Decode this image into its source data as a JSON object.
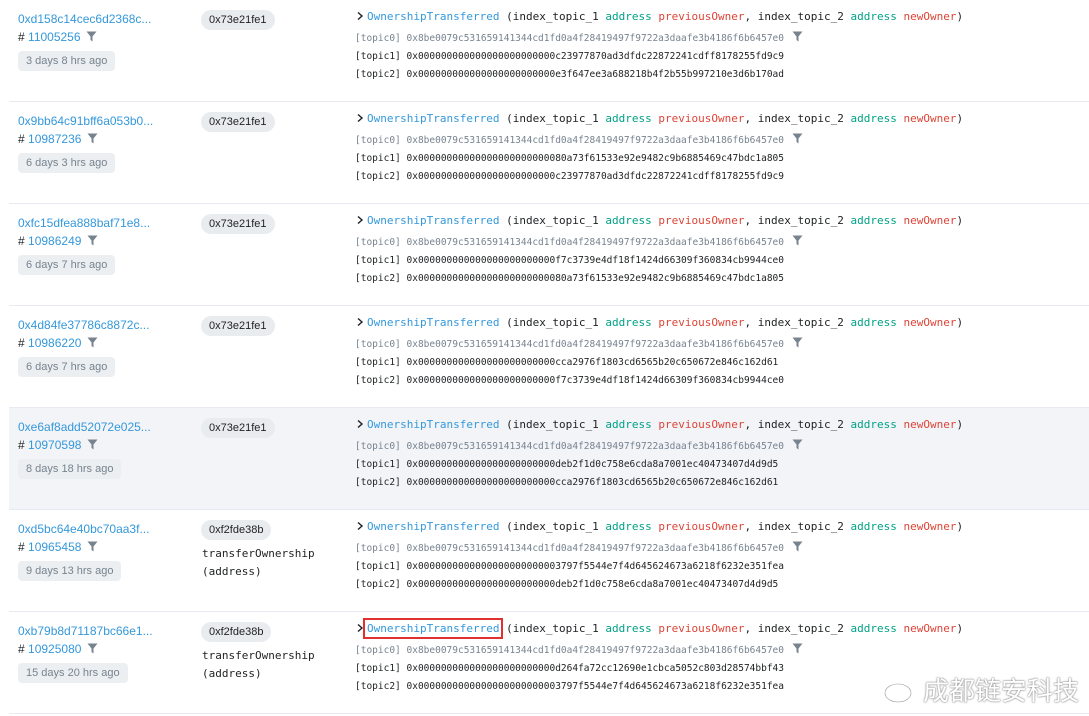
{
  "event_signature": {
    "name": "OwnershipTransferred",
    "open": "(index_topic_1",
    "kw1": "address",
    "p1": "previousOwner",
    "mid": ", index_topic_2",
    "kw2": "address",
    "p2": "newOwner",
    "close": ")"
  },
  "topic_labels": [
    "[topic0]",
    "[topic1]",
    "[topic2]"
  ],
  "rows": [
    {
      "tx_hash": "0xd158c14cec6d2368c...",
      "block": "11005256",
      "age": "3 days 8 hrs ago",
      "method": "0x73e21fe1",
      "method_name": "",
      "topics": [
        "0x8be0079c531659141344cd1fd0a4f28419497f9722a3daafe3b4186f6b6457e0",
        "0x000000000000000000000000c23977870ad3dfdc22872241cdff8178255fd9c9",
        "0x000000000000000000000000e3f647ee3a688218b4f2b55b997210e3d6b170ad"
      ]
    },
    {
      "tx_hash": "0x9bb64c91bff6a053b0...",
      "block": "10987236",
      "age": "6 days 3 hrs ago",
      "method": "0x73e21fe1",
      "method_name": "",
      "topics": [
        "0x8be0079c531659141344cd1fd0a4f28419497f9722a3daafe3b4186f6b6457e0",
        "0x00000000000000000000000080a73f61533e92e9482c9b6885469c47bdc1a805",
        "0x000000000000000000000000c23977870ad3dfdc22872241cdff8178255fd9c9"
      ]
    },
    {
      "tx_hash": "0xfc15dfea888baf71e8...",
      "block": "10986249",
      "age": "6 days 7 hrs ago",
      "method": "0x73e21fe1",
      "method_name": "",
      "topics": [
        "0x8be0079c531659141344cd1fd0a4f28419497f9722a3daafe3b4186f6b6457e0",
        "0x000000000000000000000000f7c3739e4df18f1424d66309f360834cb9944ce0",
        "0x00000000000000000000000080a73f61533e92e9482c9b6885469c47bdc1a805"
      ]
    },
    {
      "tx_hash": "0x4d84fe37786c8872c...",
      "block": "10986220",
      "age": "6 days 7 hrs ago",
      "method": "0x73e21fe1",
      "method_name": "",
      "topics": [
        "0x8be0079c531659141344cd1fd0a4f28419497f9722a3daafe3b4186f6b6457e0",
        "0x000000000000000000000000cca2976f1803cd6565b20c650672e846c162d61",
        "0x000000000000000000000000f7c3739e4df18f1424d66309f360834cb9944ce0"
      ]
    },
    {
      "tx_hash": "0xe6af8add52072e025...",
      "block": "10970598",
      "age": "8 days 18 hrs ago",
      "method": "0x73e21fe1",
      "method_name": "",
      "topics": [
        "0x8be0079c531659141344cd1fd0a4f28419497f9722a3daafe3b4186f6b6457e0",
        "0x000000000000000000000000deb2f1d0c758e6cda8a7001ec40473407d4d9d5",
        "0x000000000000000000000000cca2976f1803cd6565b20c650672e846c162d61"
      ]
    },
    {
      "tx_hash": "0xd5bc64e40bc70aa3f...",
      "block": "10965458",
      "age": "9 days 13 hrs ago",
      "method": "0xf2fde38b",
      "method_name": "transferOwnership (address)",
      "topics": [
        "0x8be0079c531659141344cd1fd0a4f28419497f9722a3daafe3b4186f6b6457e0",
        "0x0000000000000000000000003797f5544e7f4d645624673a6218f6232e351fea",
        "0x000000000000000000000000deb2f1d0c758e6cda8a7001ec40473407d4d9d5"
      ]
    },
    {
      "tx_hash": "0xb79b8d71187bc66e1...",
      "block": "10925080",
      "age": "15 days 20 hrs ago",
      "method": "0xf2fde38b",
      "method_name": "transferOwnership (address)",
      "topics": [
        "0x8be0079c531659141344cd1fd0a4f28419497f9722a3daafe3b4186f6b6457e0",
        "0x000000000000000000000000d264fa72cc12690e1cbca5052c803d28574bbf43",
        "0x0000000000000000000000003797f5544e7f4d645624673a6218f6232e351fea"
      ]
    }
  ],
  "watermark": "成都链安科技",
  "icons": {
    "filter": "filter-icon",
    "chevron": "chevron-right-icon",
    "watermark": "weibo-icon"
  },
  "colors": {
    "link": "#3498db",
    "keyword": "#00a186",
    "param": "#de4437",
    "highlight_box": "#e03030"
  }
}
